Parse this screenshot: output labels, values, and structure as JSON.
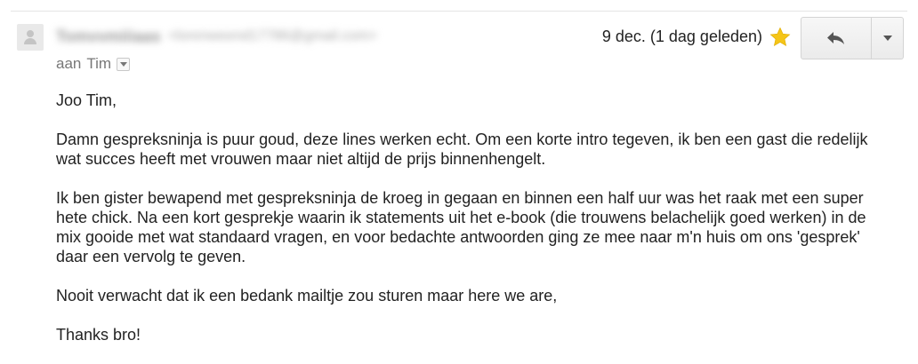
{
  "email": {
    "sender_name": "Tomvvmiiiaas",
    "sender_email": "<lorenweend17786@gmail.com>",
    "recipient_prefix": "aan",
    "recipient_name": "Tim",
    "date": "9 dec. (1 dag geleden)",
    "starred": true,
    "star_color": "#f5c518",
    "icons": {
      "avatar": "default-avatar-icon",
      "star": "star-icon",
      "reply": "reply-arrow-icon",
      "more": "caret-down-icon",
      "details": "caret-down-icon"
    },
    "body": {
      "greeting": "Joo Tim,",
      "paragraph_1": "Damn gespreksninja is puur goud, deze lines werken echt. Om een korte intro tegeven, ik ben een gast die redelijk wat succes heeft met vrouwen maar niet altijd de prijs binnenhengelt.",
      "paragraph_2": "Ik ben gister bewapend met gespreksninja de kroeg in gegaan en binnen een half uur was het raak met een super hete chick. Na een kort gesprekje waarin ik statements uit het e-book (die trouwens belachelijk goed werken) in de mix gooide met wat standaard vragen, en voor bedachte antwoorden ging ze mee naar m'n huis om ons 'gesprek' daar een vervolg te geven.",
      "paragraph_3": "Nooit verwacht dat ik een bedank mailtje zou sturen maar here we are,",
      "closing": "Thanks bro!"
    }
  }
}
